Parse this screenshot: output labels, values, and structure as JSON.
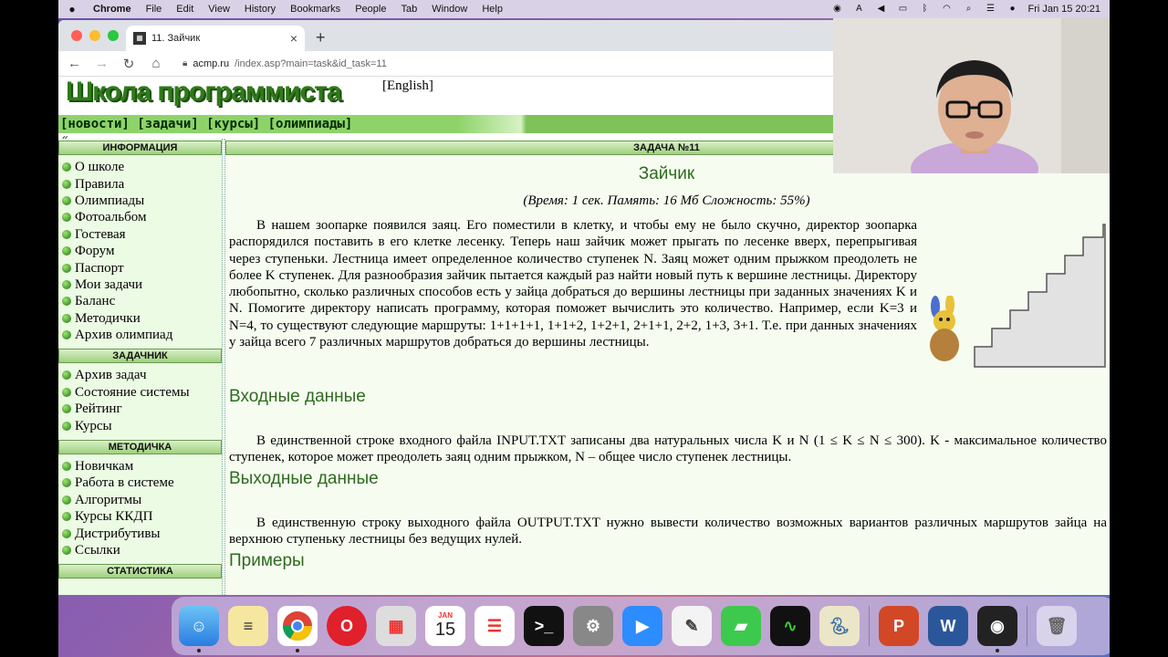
{
  "menubar": {
    "app_name": "Chrome",
    "menus": [
      "File",
      "Edit",
      "View",
      "History",
      "Bookmarks",
      "People",
      "Tab",
      "Window",
      "Help"
    ],
    "datetime": "Fri Jan 15  20:21"
  },
  "browser": {
    "tab_title": "11. Зайчик",
    "url_domain": "acmp.ru",
    "url_path": "/index.asp?main=task&id_task=11"
  },
  "site": {
    "logo": "Школа программиста",
    "lang_link": "[English]",
    "nav": [
      "[новости]",
      "[задачи]",
      "[курсы]",
      "[олимпиады]"
    ],
    "nav_extra": "«"
  },
  "sidebar": {
    "sections": [
      {
        "title": "ИНФОРМАЦИЯ",
        "items": [
          "О школе",
          "Правила",
          "Олимпиады",
          "Фотоальбом",
          "Гостевая",
          "Форум",
          "Паспорт",
          "Мои задачи",
          "Баланс",
          "Методички",
          "Архив олимпиад"
        ]
      },
      {
        "title": "ЗАДАЧНИК",
        "items": [
          "Архив задач",
          "Состояние системы",
          "Рейтинг",
          "Курсы"
        ]
      },
      {
        "title": "МЕТОДИЧКА",
        "items": [
          "Новичкам",
          "Работа в системе",
          "Алгоритмы",
          "Курсы ККДП",
          "Дистрибутивы",
          "Ссылки"
        ]
      },
      {
        "title": "СТАТИСТИКА",
        "items": []
      }
    ]
  },
  "task": {
    "header": "ЗАДАЧА №11",
    "title": "Зайчик",
    "meta": "(Время: 1 сек. Память: 16 Мб Сложность: 55%)",
    "statement": "В нашем зоопарке появился заяц. Его поместили в клетку, и чтобы ему не было скучно, директор зоопарка распорядился поставить в его клетке лесенку. Теперь наш зайчик может прыгать по лесенке вверх, перепрыгивая через ступеньки. Лестница имеет определенное количество ступенек N. Заяц может одним прыжком преодолеть не более K ступенек. Для разнообразия зайчик пытается каждый раз найти новый путь к вершине лестницы. Директору любопытно, сколько различных способов есть у зайца добраться до вершины лестницы при заданных значениях K и N. Помогите директору написать программу, которая поможет вычислить это количество. Например, если K=3 и N=4, то существуют следующие маршруты: 1+1+1+1, 1+1+2, 1+2+1, 2+1+1, 2+2, 1+3, 3+1. Т.е. при данных значениях у зайца всего 7 различных маршрутов добраться до вершины лестницы.",
    "input_title": "Входные данные",
    "input_text": "В единственной строке входного файла INPUT.TXT записаны два натуральных числа K и N (1 ≤ K ≤ N ≤ 300). K - максимальное количество ступенек, которое может преодолеть заяц одним прыжком, N – общее число ступенек лестницы.",
    "output_title": "Выходные данные",
    "output_text": "В единственную строку выходного файла OUTPUT.TXT нужно вывести количество возможных вариантов различных маршрутов зайца на верхнюю ступеньку лестницы без ведущих нулей.",
    "examples_title": "Примеры"
  },
  "dock": {
    "calendar_month": "JAN",
    "calendar_day": "15"
  }
}
